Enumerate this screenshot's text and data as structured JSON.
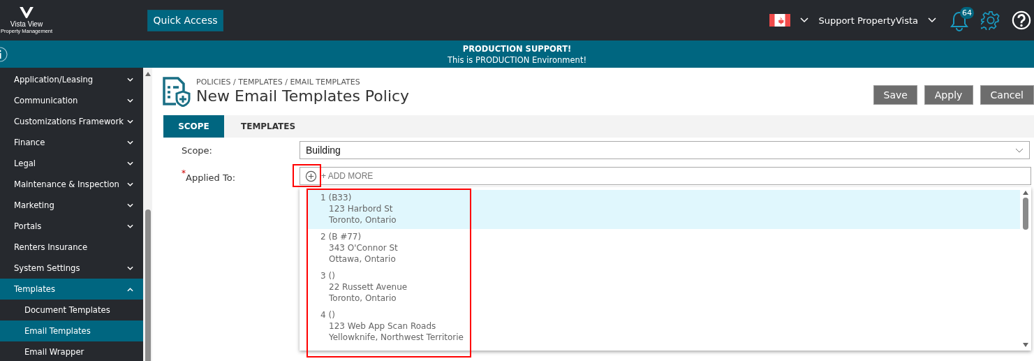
{
  "header": {
    "logo_name": "Vista View",
    "logo_tagline": "Property Management",
    "quick_access": "Quick Access",
    "user": "Support PropertyVista",
    "notifications": "64"
  },
  "banner": {
    "title": "PRODUCTION SUPPORT!",
    "message": "This is PRODUCTION Environment!"
  },
  "sidebar": {
    "items": [
      {
        "label": "Application/Leasing",
        "expandable": true,
        "expanded": false,
        "selected": false
      },
      {
        "label": "Communication",
        "expandable": true,
        "expanded": false,
        "selected": false
      },
      {
        "label": "Customizations Framework",
        "expandable": true,
        "expanded": false,
        "selected": false
      },
      {
        "label": "Finance",
        "expandable": true,
        "expanded": false,
        "selected": false
      },
      {
        "label": "Legal",
        "expandable": true,
        "expanded": false,
        "selected": false
      },
      {
        "label": "Maintenance & Inspection",
        "expandable": true,
        "expanded": false,
        "selected": false
      },
      {
        "label": "Marketing",
        "expandable": true,
        "expanded": false,
        "selected": false
      },
      {
        "label": "Portals",
        "expandable": true,
        "expanded": false,
        "selected": false
      },
      {
        "label": "Renters Insurance",
        "expandable": false,
        "selected": false
      },
      {
        "label": "System Settings",
        "expandable": true,
        "expanded": false,
        "selected": false
      },
      {
        "label": "Templates",
        "expandable": true,
        "expanded": true,
        "selected": true,
        "children": [
          {
            "label": "Document Templates",
            "selected": false
          },
          {
            "label": "Email Templates",
            "selected": true
          },
          {
            "label": "Email Wrapper",
            "selected": false
          }
        ]
      }
    ]
  },
  "page": {
    "breadcrumb": "POLICIES / TEMPLATES / EMAIL TEMPLATES",
    "title": "New Email Templates Policy",
    "buttons": [
      "Save",
      "Apply",
      "Cancel"
    ]
  },
  "tabs": [
    {
      "label": "SCOPE",
      "selected": true
    },
    {
      "label": "TEMPLATES",
      "selected": false
    }
  ],
  "form": {
    "scope": {
      "label": "Scope:",
      "value": "Building"
    },
    "applied_to": {
      "label": "Applied To:",
      "required_mark": "*",
      "placeholder": "+ ADD MORE",
      "highlight": true
    }
  },
  "dropdown": {
    "highlight": true,
    "options": [
      {
        "title": "1 (B33)",
        "street": "123 Harbord St",
        "city": "Toronto, Ontario",
        "selected": true
      },
      {
        "title": "2 (B #77)",
        "street": "343 O'Connor St",
        "city": "Ottawa, Ontario",
        "selected": false
      },
      {
        "title": "3 ()",
        "street": "22 Russett Avenue",
        "city": "Toronto, Ontario",
        "selected": false
      },
      {
        "title": "4 ()",
        "street": "123 Web App Scan Roads",
        "city": "Yellowknife, Northwest Territorie",
        "selected": false
      }
    ]
  }
}
